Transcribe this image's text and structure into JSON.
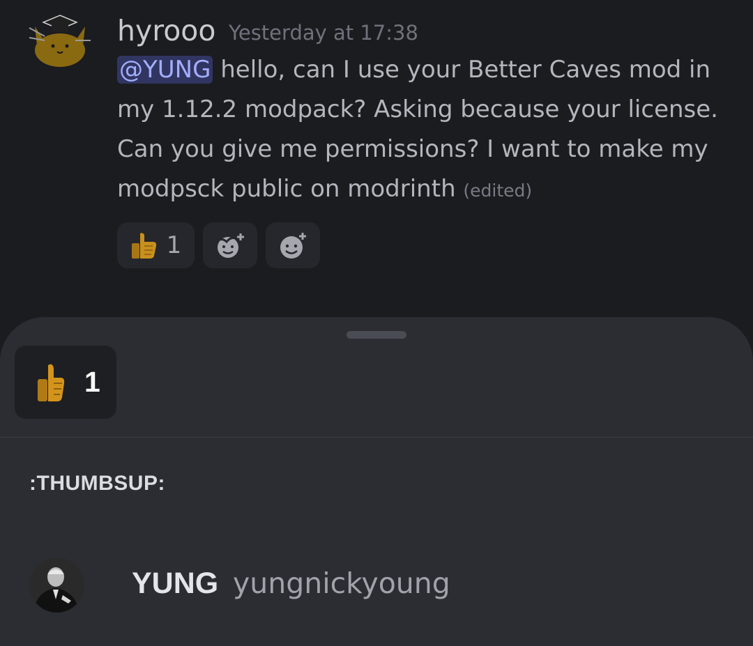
{
  "message": {
    "username": "hyrooo",
    "timestamp": "Yesterday at 17:38",
    "mention": "@YUNG",
    "text": " hello, can I use your Better Caves mod in my 1.12.2 modpack? Asking because your license. Can you give me permissions? I want to make my modpsck public on modrinth ",
    "edited": "(edited)"
  },
  "reactions": [
    {
      "emoji": "thumbs-up",
      "count": "1"
    }
  ],
  "reaction_sheet": {
    "selected_reaction": {
      "emoji": "thumbs-up",
      "count": "1"
    },
    "emoji_name": ":THUMBSUP:",
    "reactors": [
      {
        "display_name": "YUNG",
        "username": "yungnickyoung"
      }
    ]
  },
  "colors": {
    "background": "#1b1c20",
    "sheet": "#2c2d33",
    "mention_bg": "#313561",
    "mention_text": "#a3aefc",
    "thumb": "#d4941c"
  }
}
